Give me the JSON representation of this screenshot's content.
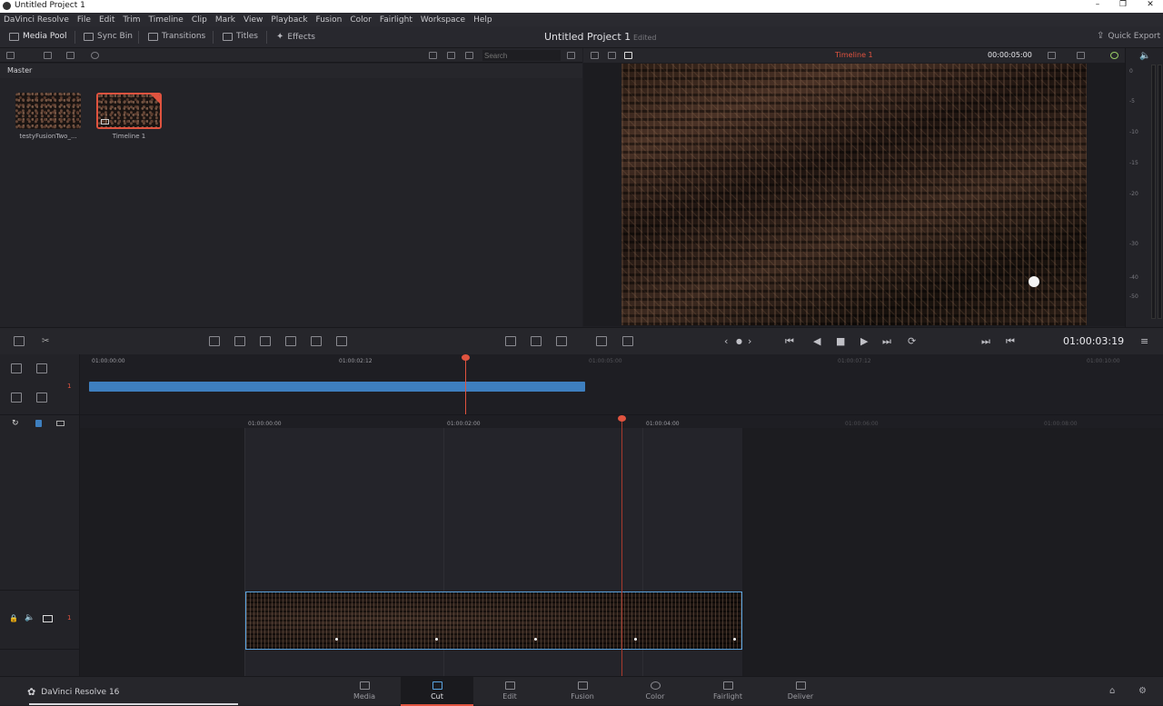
{
  "window": {
    "title": "Untitled Project 1",
    "minimize": "–",
    "restore": "❐",
    "close": "✕"
  },
  "menu": [
    "DaVinci Resolve",
    "File",
    "Edit",
    "Trim",
    "Timeline",
    "Clip",
    "Mark",
    "View",
    "Playback",
    "Fusion",
    "Color",
    "Fairlight",
    "Workspace",
    "Help"
  ],
  "toolbar": {
    "media_pool": "Media Pool",
    "sync_bin": "Sync Bin",
    "transitions": "Transitions",
    "titles": "Titles",
    "effects": "Effects",
    "project_title": "Untitled Project 1",
    "status": "Edited",
    "quick_export": "Quick Export"
  },
  "pool": {
    "search_placeholder": "Search",
    "bin": "Master",
    "clips": [
      {
        "name": "testyFusionTwo_..."
      },
      {
        "name": "Timeline 1"
      }
    ]
  },
  "viewer": {
    "timeline_name": "Timeline 1",
    "duration": "00:00:05:00",
    "timecode": "01:00:03:19"
  },
  "meter": {
    "ticks": [
      "0",
      "-5",
      "-10",
      "-15",
      "-20",
      "-30",
      "-40",
      "-50"
    ]
  },
  "upper_ruler": {
    "labels": [
      "01:00:00:00",
      "01:00:02:12",
      "01:00:05:00",
      "01:00:07:12",
      "01:00:10:00"
    ],
    "track": "1"
  },
  "lower_ruler": {
    "labels": [
      "01:00:00:00",
      "01:00:02:00",
      "01:00:04:00",
      "01:00:06:00",
      "01:00:08:00"
    ],
    "track": "1"
  },
  "bottom": {
    "brand": "DaVinci Resolve 16",
    "pages": [
      "Media",
      "Cut",
      "Edit",
      "Fusion",
      "Color",
      "Fairlight",
      "Deliver"
    ],
    "active_page": "Cut"
  }
}
